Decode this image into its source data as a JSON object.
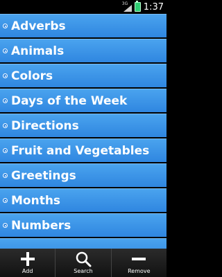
{
  "status": {
    "network": "3G",
    "time": "1:37"
  },
  "categories": [
    {
      "label": "Adverbs"
    },
    {
      "label": "Animals"
    },
    {
      "label": "Colors"
    },
    {
      "label": "Days of the Week"
    },
    {
      "label": "Directions"
    },
    {
      "label": "Fruit and Vegetables"
    },
    {
      "label": "Greetings"
    },
    {
      "label": "Months"
    },
    {
      "label": "Numbers"
    }
  ],
  "toolbar": {
    "add_label": "Add",
    "search_label": "Search",
    "remove_label": "Remove"
  },
  "colors": {
    "row": "#3a93e6",
    "accent": "#2ecc71"
  }
}
